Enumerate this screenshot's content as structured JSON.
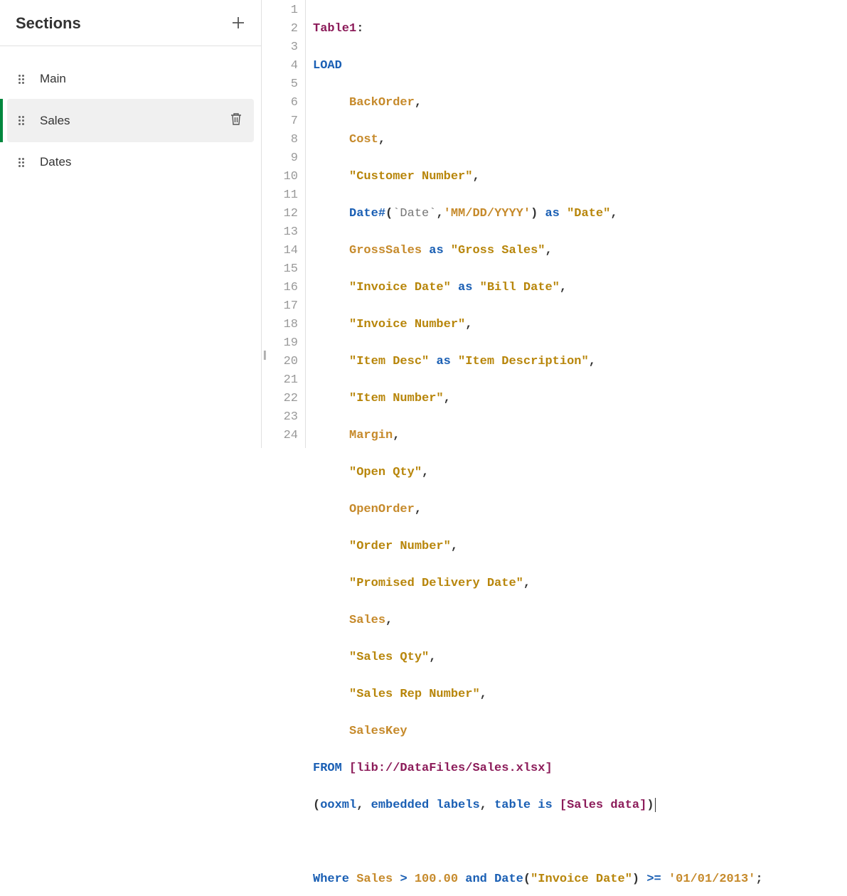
{
  "sidebar": {
    "title": "Sections",
    "items": [
      {
        "label": "Main",
        "selected": false
      },
      {
        "label": "Sales",
        "selected": true
      },
      {
        "label": "Dates",
        "selected": false
      }
    ]
  },
  "code": {
    "line_count": 24,
    "line1": {
      "table": "Table1",
      "colon": ":"
    },
    "line2": {
      "load": "LOAD"
    },
    "line3": {
      "field": "BackOrder",
      "comma": ","
    },
    "line4": {
      "field": "Cost",
      "comma": ","
    },
    "line5": {
      "qfield": "\"Customer Number\"",
      "comma": ","
    },
    "line6": {
      "fn": "Date#",
      "open": "(",
      "bq": "`Date`",
      "c1": ",",
      "fmt": "'MM/DD/YYYY'",
      "close": ")",
      "as": "as",
      "alias": "\"Date\"",
      "comma": ","
    },
    "line7": {
      "field": "GrossSales",
      "as": "as",
      "alias": "\"Gross Sales\"",
      "comma": ","
    },
    "line8": {
      "qfield": "\"Invoice Date\"",
      "as": "as",
      "alias": "\"Bill Date\"",
      "comma": ","
    },
    "line9": {
      "qfield": "\"Invoice Number\"",
      "comma": ","
    },
    "line10": {
      "qfield": "\"Item Desc\"",
      "as": "as",
      "alias": "\"Item Description\"",
      "comma": ","
    },
    "line11": {
      "qfield": "\"Item Number\"",
      "comma": ","
    },
    "line12": {
      "field": "Margin",
      "comma": ","
    },
    "line13": {
      "qfield": "\"Open Qty\"",
      "comma": ","
    },
    "line14": {
      "field": "OpenOrder",
      "comma": ","
    },
    "line15": {
      "qfield": "\"Order Number\"",
      "comma": ","
    },
    "line16": {
      "qfield": "\"Promised Delivery Date\"",
      "comma": ","
    },
    "line17": {
      "field": "Sales",
      "comma": ","
    },
    "line18": {
      "qfield": "\"Sales Qty\"",
      "comma": ","
    },
    "line19": {
      "qfield": "\"Sales Rep Number\"",
      "comma": ","
    },
    "line20": {
      "field": "SalesKey"
    },
    "line21": {
      "from": "FROM",
      "sp": " ",
      "path": "[lib://DataFiles/Sales.xlsx]"
    },
    "line22": {
      "open": "(",
      "a": "ooxml",
      "c1": ",",
      "b": "embedded",
      "c": "labels",
      "c2": ",",
      "d": "table",
      "is": "is",
      "tbl": "[Sales data]",
      "close": ")"
    },
    "line24": {
      "where": "Where",
      "fld": "Sales",
      "op1": ">",
      "num": "100.00",
      "and": "and",
      "fn": "Date",
      "open": "(",
      "arg": "\"Invoice Date\"",
      "close": ")",
      "op2": ">=",
      "lit": "'01/01/2013'",
      "semi": ";"
    }
  }
}
